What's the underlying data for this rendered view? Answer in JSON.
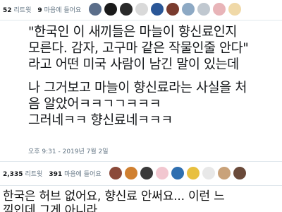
{
  "top_stats": {
    "retweets": {
      "count": "52",
      "label": "리트윗"
    },
    "likes": {
      "count": "9",
      "label": "마음에 들어요"
    }
  },
  "top_avatars": [
    {
      "color": "#5b6e8a"
    },
    {
      "color": "#1a1a1a"
    },
    {
      "color": "#2a2a2a"
    },
    {
      "color": "#d9d9d9"
    },
    {
      "color": "#2b5797"
    },
    {
      "color": "#7a3b2e"
    },
    {
      "color": "#8da9c4"
    },
    {
      "color": "#c0c8d0"
    },
    {
      "color": "#e8b4b8"
    },
    {
      "color": "#f0d9a8"
    }
  ],
  "tweet": {
    "line1": "\"한국인 이 새끼들은 마늘이 향신료인지",
    "line2": "모른다. 감자, 고구마 같은 작물인줄 안다\"",
    "line3": "라고 어떤 미국 사람이 남긴 말이 있는데",
    "line4": "나 그거보고 마늘이 향신료라는 사실을 처",
    "line5": "음 알았어ㅋㅋㄱㄱㅋㅋㅋ",
    "line6": "그러네ㅋㅋ 향신료네ㅋㅋㅋ"
  },
  "timestamp": "오후 9:31 - 2019년 7월 2일",
  "bottom_stats": {
    "retweets": {
      "count": "2,335",
      "label": "리트윗"
    },
    "likes": {
      "count": "391",
      "label": "마음에 들어요"
    }
  },
  "bottom_avatars": [
    {
      "color": "#8b4a3a"
    },
    {
      "color": "#d08030"
    },
    {
      "color": "#3a3a3a"
    },
    {
      "color": "#f2c7d0"
    },
    {
      "color": "#2f6fb0"
    },
    {
      "color": "#e8c040"
    },
    {
      "color": "#e8e8e8"
    },
    {
      "color": "#c9a27a"
    },
    {
      "color": "#6a4a3a"
    }
  ],
  "comment": "한국은 허브 없어요, 향신료 안써요... 이런 느\n낌인데 그게 아니라"
}
